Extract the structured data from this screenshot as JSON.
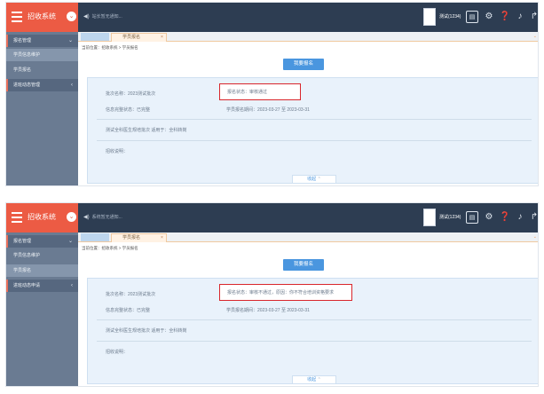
{
  "screens": [
    {
      "header": {
        "system_name": "招收系统",
        "notice": "站长暂无通知...",
        "user": "测试(1234)"
      },
      "sidebar": {
        "group1": "报名管理",
        "items": [
          "学员信息维护",
          "学员报名"
        ],
        "active_index": 0,
        "group2": "进班动态管理"
      },
      "tab": {
        "label": "学员报名",
        "close": "×"
      },
      "breadcrumb": "当前位置：招收系统 > 学员报名",
      "button": "我要报名",
      "info": {
        "batch": "批次名称：2023测试批次",
        "status": "报名状态：审核通过",
        "info_status": "信息完整状态：已完整",
        "period": "学员报名期间：2023-03-27 至 2023-03-31",
        "desc": "测试全科医生规培批次 适用于：全科转岗",
        "remark": "招收说明："
      },
      "collapse": "收起"
    },
    {
      "header": {
        "system_name": "招收系统",
        "notice": "系统暂无通知...",
        "user": "测试(1234)"
      },
      "sidebar": {
        "group1": "报名管理",
        "items": [
          "学员信息维护",
          "学员报名"
        ],
        "active_index": 1,
        "group2": "进班动态申请"
      },
      "tab": {
        "label": "学员报名",
        "close": "×"
      },
      "breadcrumb": "当前位置：招收系统 > 学员报名",
      "button": "我要报名",
      "info": {
        "batch": "批次名称：2023测试批次",
        "status": "报名状态：审核不通过，原因：你不符合培训资格要求",
        "info_status": "信息完整状态：已完整",
        "period": "学员报名期间：2023-03-27 至 2023-03-31",
        "desc": "测试全科医生规培批次 适用于：全科转岗",
        "remark": "招收说明："
      },
      "collapse": "收起"
    }
  ],
  "icons": {
    "hamburger": "hamburger-icon",
    "notice": "speaker-icon",
    "toolbar": [
      "display-icon",
      "gear-icon",
      "help-icon",
      "bell-icon",
      "share-icon"
    ]
  },
  "colors": {
    "topbar": "#2d3d52",
    "logo": "#ec5b44",
    "sidebar": "#6a7b92",
    "accent_button": "#4a96df",
    "status_highlight": "#d9262c"
  }
}
